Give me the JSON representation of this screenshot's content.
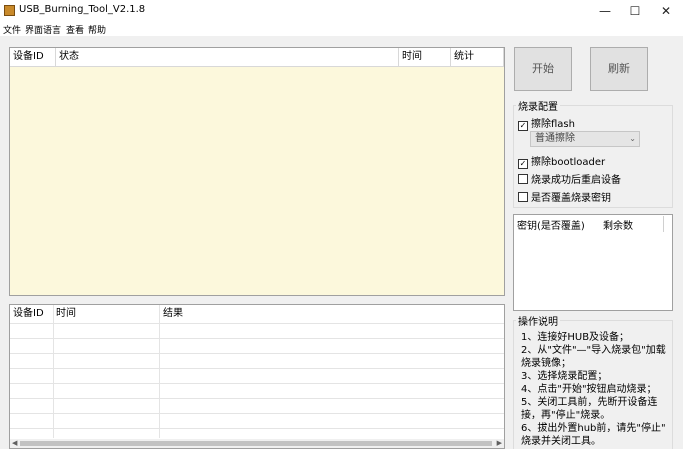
{
  "window": {
    "title": "USB_Burning_Tool_V2.1.8",
    "minimize": "—",
    "maximize": "☐",
    "close": "✕"
  },
  "menu": [
    "文件",
    "界面语言",
    "查看",
    "帮助"
  ],
  "top_table": {
    "columns": [
      "设备ID",
      "状态",
      "时间",
      "统计"
    ]
  },
  "bottom_table": {
    "columns": [
      "设备ID",
      "时间",
      "结果"
    ],
    "rows": 8
  },
  "buttons": {
    "start": "开始",
    "refresh": "刷新"
  },
  "burn_config": {
    "title": "烧录配置",
    "erase_flash": {
      "label": "擦除flash",
      "checked": true
    },
    "erase_mode": {
      "value": "普通擦除"
    },
    "erase_bootloader": {
      "label": "擦除bootloader",
      "checked": true
    },
    "reboot_after": {
      "label": "烧录成功后重启设备",
      "checked": false
    },
    "overwrite_key": {
      "label": "是否覆盖烧录密钥",
      "checked": false
    }
  },
  "keys_table": {
    "col1": "密钥(是否覆盖)",
    "col2": "剩余数"
  },
  "instructions": {
    "title": "操作说明",
    "lines": [
      "1、连接好HUB及设备；",
      "2、从\"文件\"—\"导入烧录包\"加载",
      "烧录镜像；",
      "3、选择烧录配置；",
      "4、点击\"开始\"按钮启动烧录；",
      "5、关闭工具前，先断开设备连",
      "接，再\"停止\"烧录。",
      "6、拔出外置hub前，请先\"停止\"",
      "烧录并关闭工具。"
    ]
  },
  "colors": {
    "log_background": "#fcf8dc",
    "window_bg": "#f0f0f0"
  }
}
